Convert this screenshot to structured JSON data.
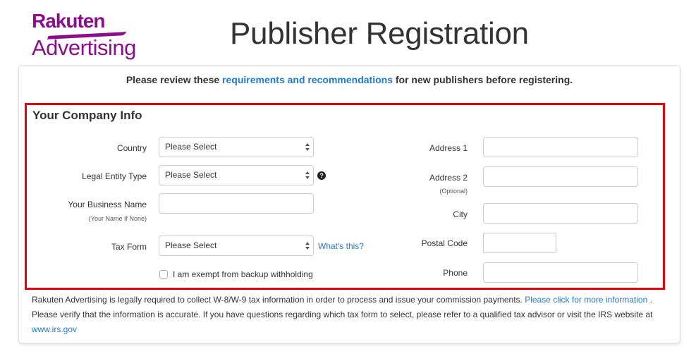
{
  "header": {
    "logo_line1": "Rakuten",
    "logo_line2": "Advertising",
    "title": "Publisher Registration"
  },
  "intro": {
    "prefix": "Please review these ",
    "link": "requirements and recommendations",
    "suffix": " for new publishers before registering."
  },
  "company_info": {
    "title": "Your Company Info",
    "left_fields": {
      "country": {
        "label": "Country",
        "value": "Please Select"
      },
      "legal_entity": {
        "label": "Legal Entity Type",
        "value": "Please Select",
        "help_icon": "?"
      },
      "business_name": {
        "label": "Your Business Name",
        "sublabel": "(Your Name If None)",
        "value": ""
      },
      "tax_form": {
        "label": "Tax Form",
        "value": "Please Select",
        "help_link": "What's this?"
      },
      "exempt": {
        "label": "I am exempt from backup withholding",
        "checked": false
      }
    },
    "right_fields": {
      "address1": {
        "label": "Address 1",
        "value": ""
      },
      "address2": {
        "label": "Address 2",
        "sublabel": "(Optional)",
        "value": ""
      },
      "city": {
        "label": "City",
        "value": ""
      },
      "postal_code": {
        "label": "Postal Code",
        "value": ""
      },
      "phone": {
        "label": "Phone",
        "value": ""
      }
    }
  },
  "notice": {
    "line1_text": "Rakuten Advertising is legally required to collect W-8/W-9 tax information in order to process and issue your commission payments. ",
    "line1_link": "Please click for more information",
    "line1_end": " .",
    "line2_text": "Please verify that the information is accurate. If you have questions regarding which tax form to select, please refer to a qualified tax advisor or visit the IRS website at",
    "irs_link": "www.irs.gov"
  },
  "colors": {
    "brand": "#8b0e8b",
    "link": "#1f7acb",
    "highlight": "#e8000b"
  }
}
